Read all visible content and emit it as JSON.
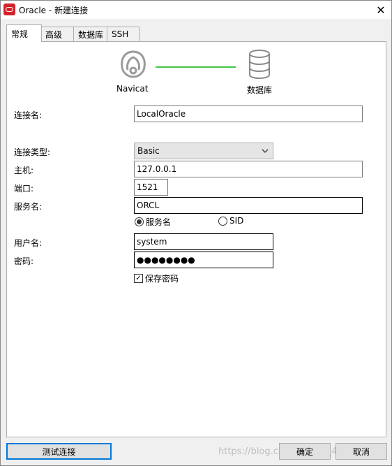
{
  "window": {
    "title": "Oracle - 新建连接"
  },
  "tabs": [
    "常规",
    "高级",
    "数据库",
    "SSH"
  ],
  "graphic": {
    "left_caption": "Navicat",
    "right_caption": "数据库",
    "line_color": "#42c842"
  },
  "form": {
    "connection_name": {
      "label": "连接名:",
      "value": "LocalOracle"
    },
    "connection_type": {
      "label": "连接类型:",
      "value": "Basic"
    },
    "host": {
      "label": "主机:",
      "value": "127.0.0.1"
    },
    "port": {
      "label": "端口:",
      "value": "1521"
    },
    "service_name": {
      "label": "服务名:",
      "value": "ORCL"
    },
    "radio_options": {
      "service_name": "服务名",
      "sid": "SID",
      "selected": "service_name"
    },
    "username": {
      "label": "用户名:",
      "value": "system"
    },
    "password": {
      "label": "密码:",
      "value": "●●●●●●●●"
    },
    "save_password": {
      "label": "保存密码",
      "checked": true
    }
  },
  "buttons": {
    "test": "测试连接",
    "ok": "确定",
    "cancel": "取消"
  },
  "watermark": "https://blog.csdn.net/qq_46584964"
}
